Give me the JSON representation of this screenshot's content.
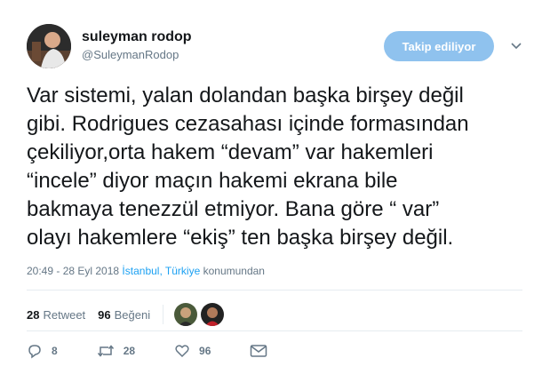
{
  "header": {
    "display_name": "suleyman rodop",
    "handle": "@SuleymanRodop",
    "follow_button": "Takip ediliyor"
  },
  "tweet": {
    "text": "Var sistemi, yalan dolandan başka birşey değil\ngibi. Rodrigues cezasahası içinde formasından\nçekiliyor,orta hakem “devam” var hakemleri\n“incele” diyor maçın hakemi ekrana bile\nbakmaya tenezzül etmiyor. Bana göre “ var”\nolayı hakemlere “ekiş” ten başka birşey değil."
  },
  "meta": {
    "time": "20:49 - 28 Eyl 2018",
    "location": "İstanbul, Türkiye",
    "suffix": "konumundan"
  },
  "stats": {
    "retweets_count": "28",
    "retweets_label": "Retweet",
    "likes_count": "96",
    "likes_label": "Beğeni"
  },
  "actions": {
    "replies": "8",
    "retweets": "28",
    "likes": "96"
  },
  "colors": {
    "accent": "#1da1f2",
    "follow_button_bg": "#8fc2ee",
    "secondary_text": "#657786"
  }
}
